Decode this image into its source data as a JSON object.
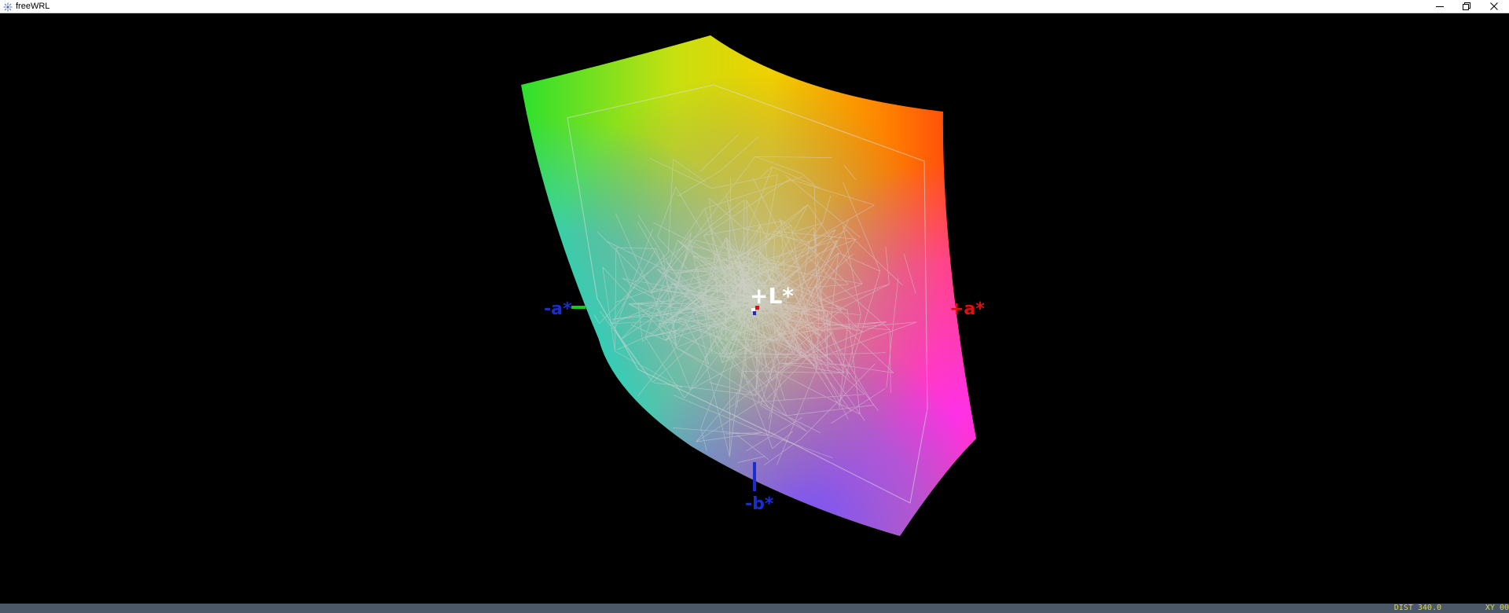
{
  "window": {
    "title": "freeWRL",
    "icon": "freewrl-app-icon",
    "controls": [
      "minimize-icon",
      "restore-icon",
      "close-icon"
    ]
  },
  "scene": {
    "description_type": "CIELAB gamut 3D view",
    "axis_labels": {
      "plus_L": "+L*",
      "minus_a": "-a*",
      "plus_a": "+a*",
      "minus_b": "-b*"
    },
    "colors": {
      "background": "#000000",
      "plus_a_label": "#e01010",
      "minus_a_label": "#1a2ed0",
      "minus_b_label": "#1a2ed0",
      "plus_L_label": "#ffffff",
      "minus_a_axis": "#22c022",
      "minus_b_axis": "#1a2ed0",
      "mesh": "#d8d8d8"
    }
  },
  "status": {
    "dist": "DIST 340.0",
    "mode": "XY 00"
  }
}
